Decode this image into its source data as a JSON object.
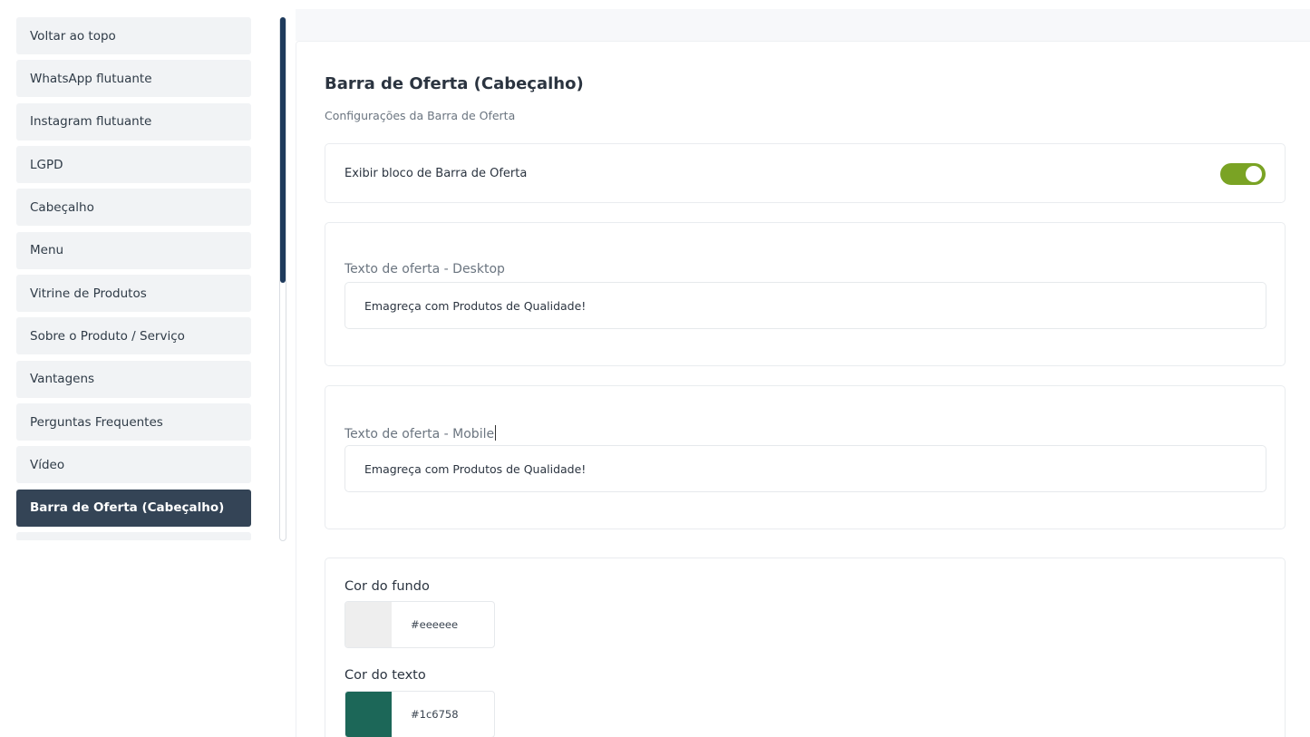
{
  "sidebar": {
    "items": [
      {
        "label": "Voltar ao topo"
      },
      {
        "label": "WhatsApp flutuante"
      },
      {
        "label": "Instagram flutuante"
      },
      {
        "label": "LGPD"
      },
      {
        "label": "Cabeçalho"
      },
      {
        "label": "Menu"
      },
      {
        "label": "Vitrine de Produtos"
      },
      {
        "label": "Sobre o Produto / Serviço"
      },
      {
        "label": "Vantagens"
      },
      {
        "label": "Perguntas Frequentes"
      },
      {
        "label": "Vídeo"
      },
      {
        "label": "Barra de Oferta (Cabeçalho)"
      }
    ],
    "active_item": "Barra de Oferta (Cabeçalho)"
  },
  "main": {
    "title": "Barra de Oferta (Cabeçalho)",
    "subtitle": "Configurações da Barra de Oferta",
    "toggle": {
      "label": "Exibir bloco de Barra de Oferta",
      "enabled": true,
      "color": "#7aa324"
    },
    "desktop": {
      "label": "Texto de oferta - Desktop",
      "value": "Emagreça com Produtos de Qualidade!"
    },
    "mobile": {
      "label": "Texto de oferta - Mobile",
      "value": "Emagreça com Produtos de Qualidade!"
    },
    "colors": {
      "background": {
        "label": "Cor do fundo",
        "hex": "#eeeeee"
      },
      "text": {
        "label": "Cor do texto",
        "hex": "#1c6758"
      }
    }
  },
  "theme": {
    "active_nav_bg": "#344456",
    "scrollbar_thumb": "#1e3a5c"
  }
}
